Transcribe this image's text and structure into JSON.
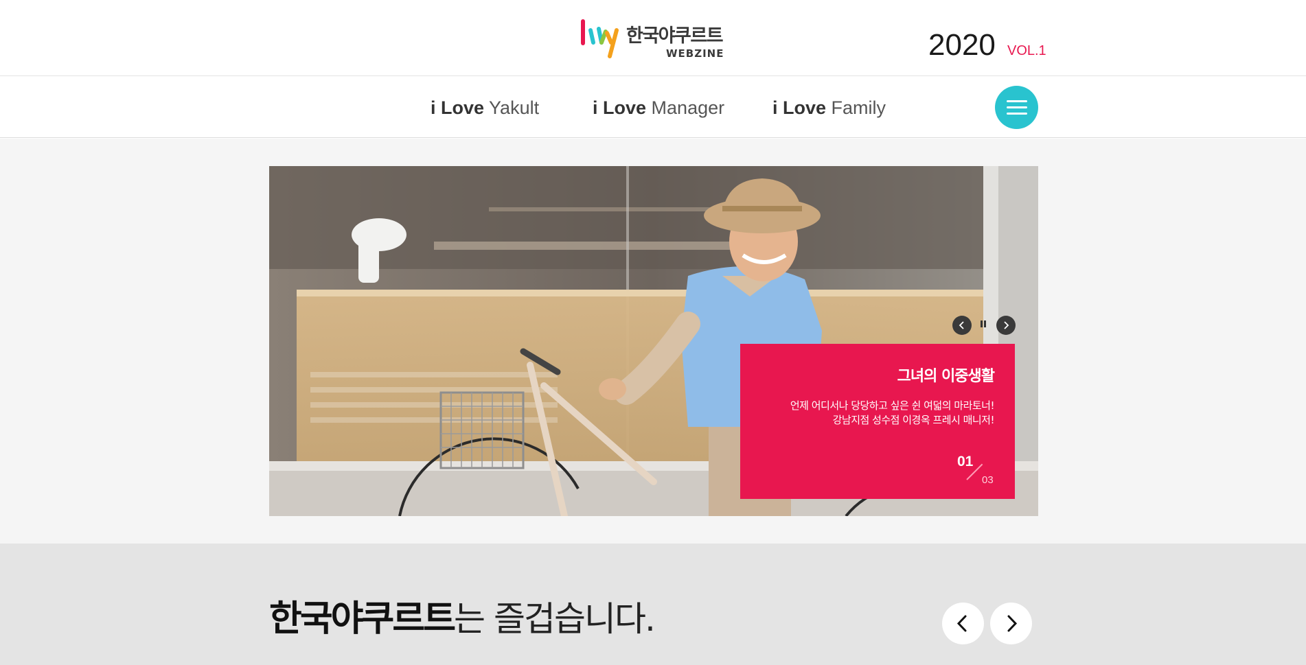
{
  "header": {
    "logo_text": "한국야쿠르트",
    "logo_sub": "WEBZINE",
    "issue_year": "2020",
    "issue_vol": "VOL.1"
  },
  "nav": {
    "items": [
      {
        "bold": "i Love",
        "light": "Yakult"
      },
      {
        "bold": "i Love",
        "light": "Manager"
      },
      {
        "bold": "i Love",
        "light": "Family"
      }
    ],
    "menu_icon": "hamburger-icon"
  },
  "slide": {
    "title": "그녀의 이중생활",
    "line1": "언제 어디서나 당당하고 싶은 쉰 여덟의 마라토너!",
    "line2": "강남지점 성수점 이경옥 프레시 매니저!",
    "current": "01",
    "total": "03",
    "controls": [
      "prev-icon",
      "pause-icon",
      "next-icon"
    ]
  },
  "section": {
    "tagline_strong": "한국야쿠르트",
    "tagline_rest": "는 즐겁습니다."
  },
  "colors": {
    "brand_red": "#e8174f",
    "menu_teal": "#29c3cf"
  }
}
